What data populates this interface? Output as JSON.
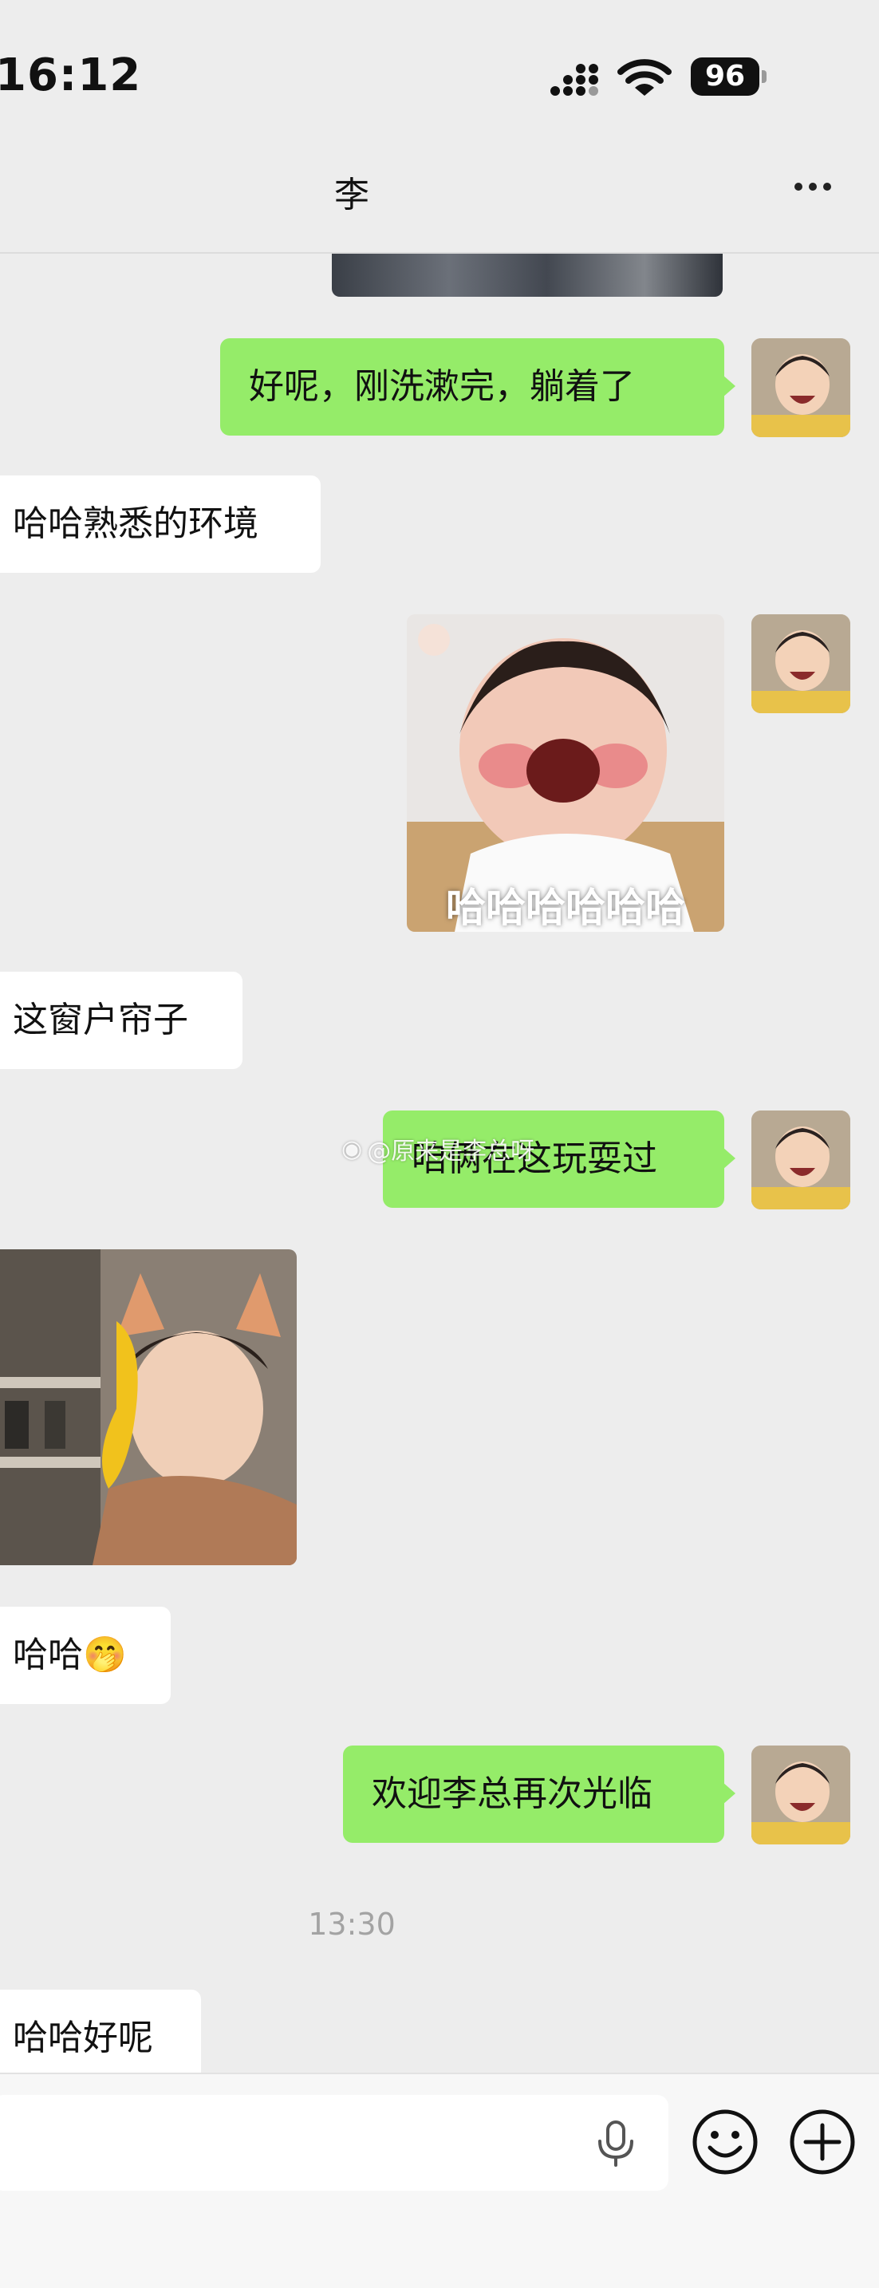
{
  "status_bar": {
    "time": "16:12",
    "battery": "96"
  },
  "header": {
    "title": "李"
  },
  "messages": [
    {
      "side": "out",
      "text": "好呢，刚洗漱完，躺着了"
    },
    {
      "side": "in",
      "text": "哈哈熟悉的环境"
    },
    {
      "side": "out",
      "image": "sticker",
      "caption": "哈哈哈哈哈哈"
    },
    {
      "side": "in",
      "text": "这窗户帘子"
    },
    {
      "side": "out",
      "text": "咱俩在这玩耍过"
    },
    {
      "side": "in",
      "image": "photo"
    },
    {
      "side": "in",
      "text": "哈哈",
      "emoji": "🤭"
    },
    {
      "side": "out",
      "text": "欢迎李总再次光临"
    },
    {
      "side": "in",
      "text": "哈哈好呢"
    }
  ],
  "timestamp": "13:30",
  "watermark": "@原来是李总呀",
  "input": {
    "placeholder": ""
  },
  "icons": {
    "mic": "microphone-icon",
    "emoji": "emoji-icon",
    "plus": "plus-icon",
    "more": "more-icon"
  },
  "colors": {
    "outgoing_bubble": "#95ec69",
    "incoming_bubble": "#ffffff",
    "background": "#ededed"
  }
}
